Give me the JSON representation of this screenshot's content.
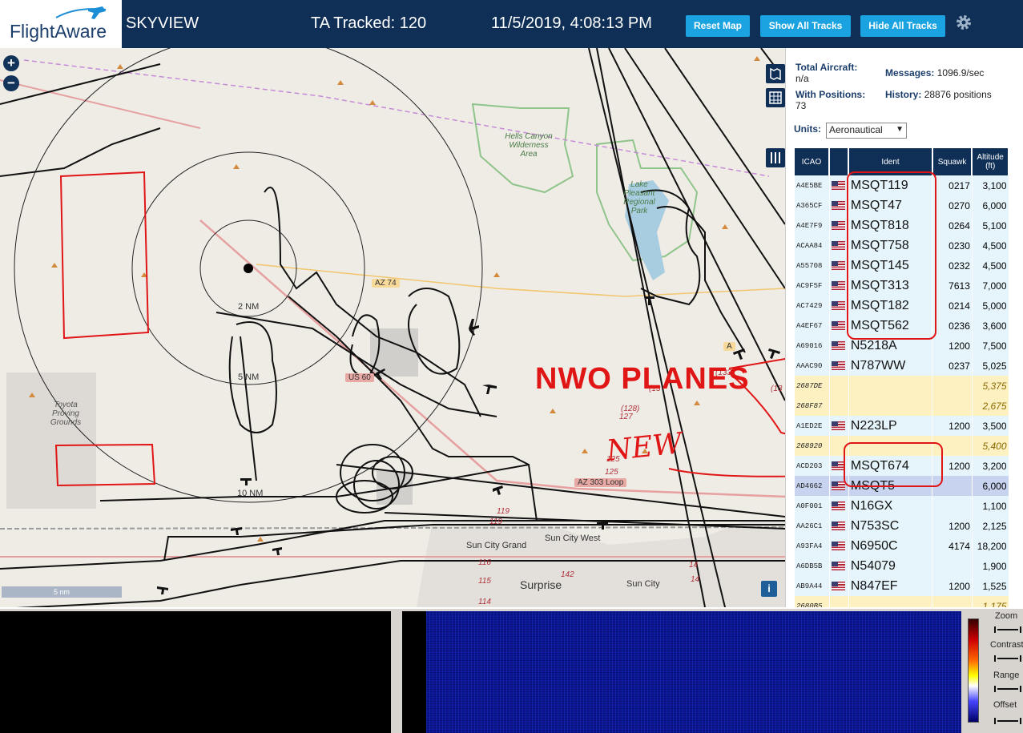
{
  "header": {
    "logo_text": "FlightAware",
    "app_title": "SKYVIEW",
    "tracked": "TA Tracked: 120",
    "datetime": "11/5/2019, 4:08:13 PM",
    "reset_label": "Reset Map",
    "show_label": "Show All Tracks",
    "hide_label": "Hide All Tracks"
  },
  "map": {
    "zoom_in": "+",
    "zoom_out": "−",
    "scale": "5 nm",
    "info": "i",
    "range_labels": [
      "2 NM",
      "5 NM",
      "10 NM"
    ],
    "places": [
      "Hells Canyon Wilderness Area",
      "Lake Pleasant Regional Park",
      "Toyota Proving Grounds",
      "Sun City Grand",
      "Sun City West",
      "Surprise",
      "Sun City"
    ],
    "roads": [
      "AZ 74",
      "US 60",
      "AZ 303 Loop",
      "A"
    ],
    "annotations": {
      "nwo": "NWO PLANES",
      "new": "NEW"
    },
    "numbers": [
      "(128)",
      "127",
      "125",
      "125",
      "119",
      "119",
      "116",
      "115",
      "114",
      "142",
      "14",
      "14",
      "(133)",
      "(13",
      "(13"
    ]
  },
  "panel": {
    "total_label": "Total Aircraft:",
    "total_value": "n/a",
    "messages_label": "Messages:",
    "messages_value": "1096.9/sec",
    "positions_label": "With Positions:",
    "positions_value": "73",
    "history_label": "History:",
    "history_value": "28876 positions",
    "units_label": "Units:",
    "units_value": "Aeronautical",
    "columns": [
      "ICAO",
      "",
      "Ident",
      "Squawk",
      "Altitude (ft)"
    ],
    "rows": [
      {
        "icao": "A4E5BE",
        "ident": "MSQT119",
        "squawk": "0217",
        "alt": "3,100",
        "style": "blue"
      },
      {
        "icao": "A365CF",
        "ident": "MSQT47",
        "squawk": "0270",
        "alt": "6,000",
        "style": "blue"
      },
      {
        "icao": "A4E7F9",
        "ident": "MSQT818",
        "squawk": "0264",
        "alt": "5,100",
        "style": "blue"
      },
      {
        "icao": "ACAA84",
        "ident": "MSQT758",
        "squawk": "0230",
        "alt": "4,500",
        "style": "blue"
      },
      {
        "icao": "A55708",
        "ident": "MSQT145",
        "squawk": "0232",
        "alt": "4,500",
        "style": "blue"
      },
      {
        "icao": "AC9F5F",
        "ident": "MSQT313",
        "squawk": "7613",
        "alt": "7,000",
        "style": "blue"
      },
      {
        "icao": "AC7429",
        "ident": "MSQT182",
        "squawk": "0214",
        "alt": "5,000",
        "style": "blue"
      },
      {
        "icao": "A4EF67",
        "ident": "MSQT562",
        "squawk": "0236",
        "alt": "3,600",
        "style": "blue"
      },
      {
        "icao": "A69016",
        "ident": "N5218A",
        "squawk": "1200",
        "alt": "7,500",
        "style": "blue"
      },
      {
        "icao": "AAAC90",
        "ident": "N787WW",
        "squawk": "0237",
        "alt": "5,025",
        "style": "blue"
      },
      {
        "icao": "2687DE",
        "ident": "",
        "squawk": "",
        "alt": "5,375",
        "style": "yellow"
      },
      {
        "icao": "268F87",
        "ident": "",
        "squawk": "",
        "alt": "2,675",
        "style": "yellow"
      },
      {
        "icao": "A1ED2E",
        "ident": "N223LP",
        "squawk": "1200",
        "alt": "3,500",
        "style": "blue"
      },
      {
        "icao": "268920",
        "ident": "",
        "squawk": "",
        "alt": "5,400",
        "style": "yellow"
      },
      {
        "icao": "ACD203",
        "ident": "MSQT674",
        "squawk": "1200",
        "alt": "3,200",
        "style": "blue"
      },
      {
        "icao": "AD4662",
        "ident": "MSQT5",
        "squawk": "",
        "alt": "6,000",
        "style": "sel"
      },
      {
        "icao": "A0F001",
        "ident": "N16GX",
        "squawk": "",
        "alt": "1,100",
        "style": "blue"
      },
      {
        "icao": "AA26C1",
        "ident": "N753SC",
        "squawk": "1200",
        "alt": "2,125",
        "style": "blue"
      },
      {
        "icao": "A93FA4",
        "ident": "N6950C",
        "squawk": "4174",
        "alt": "18,200",
        "style": "blue"
      },
      {
        "icao": "A6DB5B",
        "ident": "N54079",
        "squawk": "",
        "alt": "1,900",
        "style": "blue"
      },
      {
        "icao": "AB9A44",
        "ident": "N847EF",
        "squawk": "1200",
        "alt": "1,525",
        "style": "blue"
      },
      {
        "icao": "2680B5",
        "ident": "",
        "squawk": "",
        "alt": "1,175",
        "style": "yellow"
      }
    ]
  },
  "spectrum": {
    "zoom": "Zoom",
    "contrast": "Contrast",
    "range": "Range",
    "offset": "Offset"
  }
}
